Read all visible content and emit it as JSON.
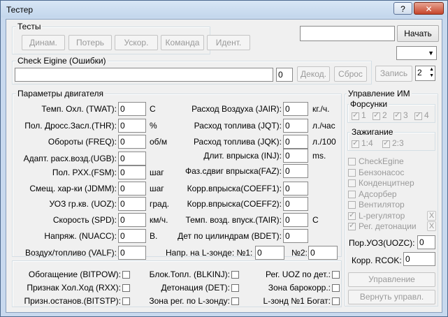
{
  "window": {
    "title": "Тестер",
    "help_glyph": "?",
    "close_glyph": "✕"
  },
  "tests": {
    "title": "Тесты",
    "buttons": [
      "Динам.",
      "Потерь",
      "Ускор.",
      "Команда",
      "Идент."
    ]
  },
  "start": {
    "input_value": "",
    "button_label": "Начать",
    "combo_value": ""
  },
  "check_engine": {
    "title": "Check Eigine (Ошибки)",
    "errors_value": "",
    "count_value": "0",
    "decode_label": "Декод.",
    "reset_label": "Сброс",
    "write_label": "Запись",
    "spin_value": "2"
  },
  "params": {
    "title": "Параметры двигателя",
    "left": [
      {
        "label": "Темп. Охл. (TWAT):",
        "value": "0",
        "unit": "C"
      },
      {
        "label": "Пол. Дросс.Засл.(THR):",
        "value": "0",
        "unit": "%"
      },
      {
        "label": "Обороты (FREQ):",
        "value": "0",
        "unit": "об/м"
      },
      {
        "label": "Адапт. расх.возд.(UGB):",
        "value": "0",
        "unit": ""
      },
      {
        "label": "Пол. РХХ.(FSM):",
        "value": "0",
        "unit": "шаг"
      },
      {
        "label": "Смещ. хар-ки (JDMM):",
        "value": "0",
        "unit": "шаг"
      },
      {
        "label": "УОЗ гр.кв. (UOZ):",
        "value": "0",
        "unit": "град."
      },
      {
        "label": "Скорость (SPD):",
        "value": "0",
        "unit": "км/ч."
      },
      {
        "label": "Напряж. (NUACC):",
        "value": "0",
        "unit": "В."
      },
      {
        "label": "Воздух/топливо (VALF):",
        "value": "0",
        "unit": ""
      }
    ],
    "right": [
      {
        "label": "Расход Воздуха (JAIR):",
        "value": "0",
        "unit": "кг./ч."
      },
      {
        "label": "Расход топлива (JQT):",
        "value": "0",
        "unit": "л./час"
      },
      {
        "label": "Расход топлива (JQK):",
        "value": "0",
        "unit": "л./100"
      },
      {
        "label": "Длит. впрыска (INJ):",
        "value": "0",
        "unit": "ms."
      },
      {
        "label": "Фаз.сдвиг впрыска(FAZ):",
        "value": "0",
        "unit": ""
      },
      {
        "label": "Корр.впрыска(COEFF1):",
        "value": "0",
        "unit": ""
      },
      {
        "label": "Корр.впрыска(COEFF2):",
        "value": "0",
        "unit": ""
      },
      {
        "label": "Темп. возд. впуск.(TAIR):",
        "value": "0",
        "unit": "C"
      },
      {
        "label": "Дет по цилиндрам (BDET):",
        "value": "0",
        "unit": ""
      }
    ],
    "lambda": {
      "label": "Напр. на L-зонде: №1:",
      "value1": "0",
      "label2": "№2:",
      "value2": "0"
    }
  },
  "flags": [
    "Обогащение (BITPOW):",
    "Блок.Топл. (BLKINJ):",
    "Рег. UOZ по дет.:",
    "Признак Хол.Ход (RXX):",
    "Детонация (DET):",
    "Зона барокорр.:",
    "Призн.останов.(BITSTP):",
    "Зона рег. по L-зонду:",
    "L-зонд №1 Богат:"
  ],
  "control": {
    "title": "Управление ИМ",
    "injectors_title": "Форсунки",
    "injectors": [
      "1",
      "2",
      "3",
      "4"
    ],
    "ignition_title": "Зажигание",
    "ignition": [
      "1:4",
      "2:3"
    ],
    "devices": [
      {
        "label": "CheckEgine",
        "checked": false,
        "x": false
      },
      {
        "label": "Бензонасос",
        "checked": false,
        "x": false
      },
      {
        "label": "Конденцитнер",
        "checked": false,
        "x": false
      },
      {
        "label": "Адсорбер",
        "checked": false,
        "x": false
      },
      {
        "label": "Вентилятор",
        "checked": false,
        "x": false
      },
      {
        "label": "L-регулятор",
        "checked": true,
        "x": true
      },
      {
        "label": "Рег. детонации",
        "checked": true,
        "x": true
      }
    ],
    "x_glyph": "X",
    "uozc_label": "Пор.УОЗ(UOZC):",
    "uozc_value": "0",
    "rcok_label": "Корр. RCOK:",
    "rcok_value": "0",
    "manage_label": "Управление",
    "return_label": "Вернуть управл."
  }
}
